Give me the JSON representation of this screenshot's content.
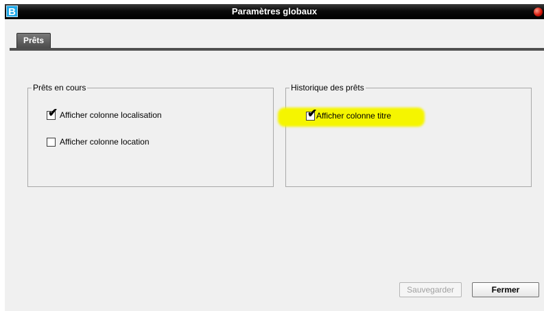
{
  "window": {
    "title": "Paramètres globaux",
    "app_icon_letter": "B"
  },
  "tabs": [
    {
      "label": "Prêts",
      "selected": true
    }
  ],
  "groups": {
    "current_loans": {
      "legend": "Prêts en cours",
      "options": [
        {
          "label": "Afficher colonne localisation",
          "checked": true
        },
        {
          "label": "Afficher colonne location",
          "checked": false
        }
      ]
    },
    "loan_history": {
      "legend": "Historique des prêts",
      "options": [
        {
          "label": "Afficher colonne titre",
          "checked": true,
          "highlighted": true
        }
      ]
    }
  },
  "buttons": {
    "save_label": "Sauvegarder",
    "save_enabled": false,
    "close_label": "Fermer"
  },
  "colors": {
    "titlebar": "#000000",
    "tab": "#5a5a5a",
    "highlight": "#f5f500",
    "close_dot": "#d4180a"
  },
  "icons": {
    "app": "app-logo-icon",
    "close": "close-window-icon",
    "check": "checkmark-icon"
  }
}
